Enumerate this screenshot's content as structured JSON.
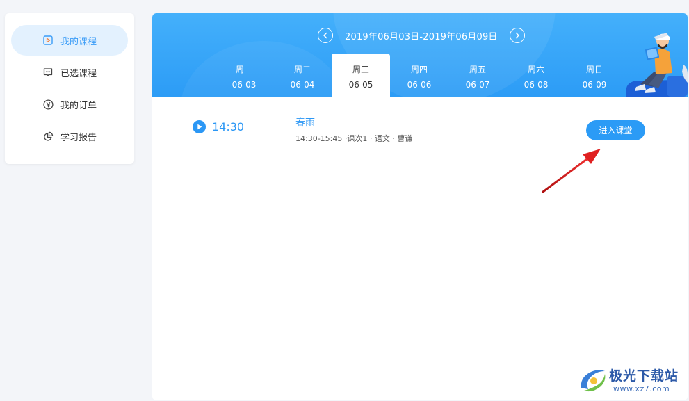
{
  "sidebar": {
    "items": [
      {
        "label": "我的课程",
        "icon": "play-square-icon",
        "active": true
      },
      {
        "label": "已选课程",
        "icon": "chat-square-icon",
        "active": false
      },
      {
        "label": "我的订单",
        "icon": "yen-circle-icon",
        "active": false
      },
      {
        "label": "学习报告",
        "icon": "pie-chart-icon",
        "active": false
      }
    ]
  },
  "week": {
    "range": "2019年06月03日-2019年06月09日",
    "days": [
      {
        "weekday": "周一",
        "date": "06-03"
      },
      {
        "weekday": "周二",
        "date": "06-04"
      },
      {
        "weekday": "周三",
        "date": "06-05"
      },
      {
        "weekday": "周四",
        "date": "06-06"
      },
      {
        "weekday": "周五",
        "date": "06-07"
      },
      {
        "weekday": "周六",
        "date": "06-08"
      },
      {
        "weekday": "周日",
        "date": "06-09"
      }
    ],
    "selected_index": 2
  },
  "lesson": {
    "time": "14:30",
    "title": "春雨",
    "meta": "14:30-15:45 ·课次1 · 语文 · 曹谦",
    "enter_label": "进入课堂"
  },
  "watermark": {
    "text": "极光下载站",
    "url": "www.xz7.com"
  },
  "colors": {
    "accent": "#2b9bf6",
    "active_bg": "#e3f1fe",
    "annotation": "#e02020"
  }
}
